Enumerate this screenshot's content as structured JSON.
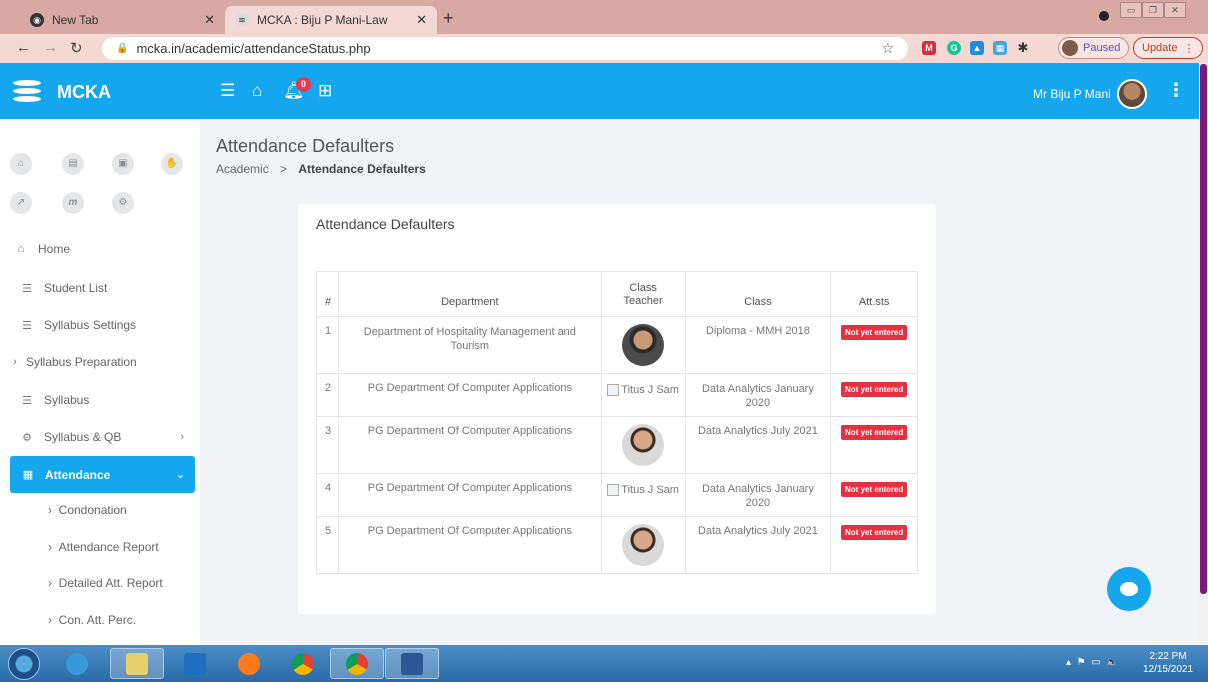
{
  "browser": {
    "tabs": [
      {
        "label": "New Tab",
        "active": false
      },
      {
        "label": "MCKA : Biju P Mani-Law",
        "active": true
      }
    ],
    "new_tab": "+",
    "url": "mcka.in/academic/attendanceStatus.php",
    "profile_status": "Paused",
    "update_label": "Update"
  },
  "header": {
    "brand": "MCKA",
    "notification_count": "0",
    "user_name": "Mr Biju P Mani",
    "accent_color": "#16a6ed"
  },
  "sidebar": {
    "quick_icons": [
      "home-icon",
      "id-card-icon",
      "lock-icon",
      "handshake-icon",
      "external-link-icon",
      "m-icon",
      "gear-icon"
    ],
    "items": [
      {
        "label": "Home",
        "icon": "home-icon"
      },
      {
        "label": "Student List",
        "icon": "list-icon"
      },
      {
        "label": "Syllabus Settings",
        "icon": "list-icon"
      },
      {
        "label": "Syllabus Preparation",
        "icon": "chevron-right-icon"
      },
      {
        "label": "Syllabus",
        "icon": "list-icon"
      },
      {
        "label": "Syllabus & QB",
        "icon": "cogs-icon"
      },
      {
        "label": "Attendance",
        "icon": "calendar-icon",
        "active": true
      }
    ],
    "subitems": [
      {
        "label": "Condonation"
      },
      {
        "label": "Attendance Report"
      },
      {
        "label": "Detailed Att. Report"
      },
      {
        "label": "Con. Att. Perc."
      }
    ]
  },
  "page": {
    "title": "Attendance Defaulters",
    "breadcrumb": {
      "parent": "Academic",
      "separator": ">",
      "current": "Attendance Defaulters"
    }
  },
  "card": {
    "title": "Attendance Defaulters",
    "columns": [
      "#",
      "Department",
      "Class Teacher",
      "Class",
      "Att.sts"
    ],
    "rows": [
      {
        "num": "1",
        "department": "Department of Hospitality Management and Tourism",
        "teacher_photo": "man",
        "teacher_alt": "",
        "class": "Diploma - MMH 2018",
        "status": "Not yet entered"
      },
      {
        "num": "2",
        "department": "PG Department Of Computer Applications",
        "teacher_photo": "broken",
        "teacher_alt": "Titus J Sam",
        "class": "Data Analytics January 2020",
        "status": "Not yet entered"
      },
      {
        "num": "3",
        "department": "PG Department Of Computer Applications",
        "teacher_photo": "woman",
        "teacher_alt": "",
        "class": "Data Analytics July 2021",
        "status": "Not yet entered"
      },
      {
        "num": "4",
        "department": "PG Department Of Computer Applications",
        "teacher_photo": "broken",
        "teacher_alt": "Titus J Sam",
        "class": "Data Analytics January 2020",
        "status": "Not yet entered"
      },
      {
        "num": "5",
        "department": "PG Department Of Computer Applications",
        "teacher_photo": "woman",
        "teacher_alt": "",
        "class": "Data Analytics July 2021",
        "status": "Not yet entered"
      }
    ],
    "status_color": "#e53042"
  },
  "taskbar": {
    "time": "2:22 PM",
    "date": "12/15/2021"
  }
}
